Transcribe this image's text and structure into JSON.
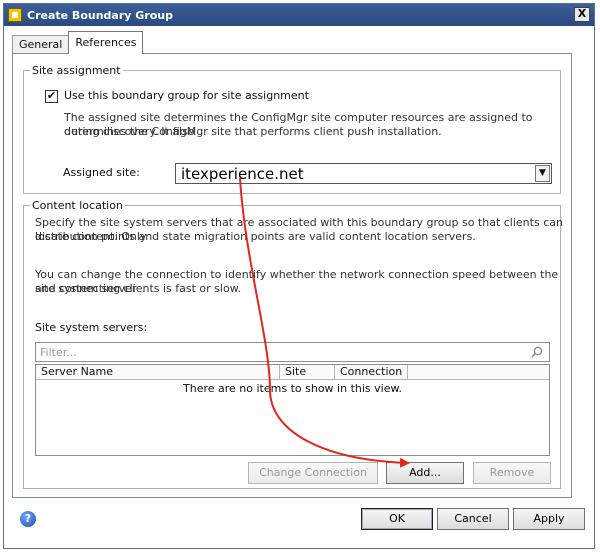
{
  "window": {
    "title": "Create Boundary Group",
    "close_glyph": "X"
  },
  "tabs": [
    {
      "label": "General"
    },
    {
      "label": "References"
    }
  ],
  "site_assignment": {
    "group_label": "Site assignment",
    "checkbox_label": "Use this boundary group for site assignment",
    "checked": true,
    "description_line1": "The assigned site determines the ConfigMgr site computer resources are assigned to during discovery. It also",
    "description_line2": "determines the ConfigMgr site that performs client push installation.",
    "assigned_site_label": "Assigned site:",
    "assigned_site_value": "itexperience.net"
  },
  "content_location": {
    "group_label": "Content location",
    "description_line1": "Specify the site system servers that are associated with this boundary group so that clients can locate content. Only",
    "description_line2": "distribution points and state migration points are valid content location servers.",
    "connection_line1": "You can change the connection to identify whether the network connection speed between the site system server",
    "connection_line2": "and connecting clients is fast or slow.",
    "servers_label": "Site system servers:",
    "filter_placeholder": "Filter...",
    "columns": [
      "Server Name",
      "Site",
      "Connection"
    ],
    "empty_message": "There are no items to show in this view.",
    "change_connection_label": "Change Connection",
    "add_label": "Add...",
    "remove_label": "Remove"
  },
  "footer": {
    "help_glyph": "?",
    "ok_label": "OK",
    "cancel_label": "Cancel",
    "apply_label": "Apply"
  },
  "colors": {
    "titlebar": "#2a4a80",
    "annotation_arrow": "#e0291c"
  },
  "icons": {
    "help": "help-icon",
    "search": "search-icon",
    "dropdown": "chevron-down-icon"
  }
}
